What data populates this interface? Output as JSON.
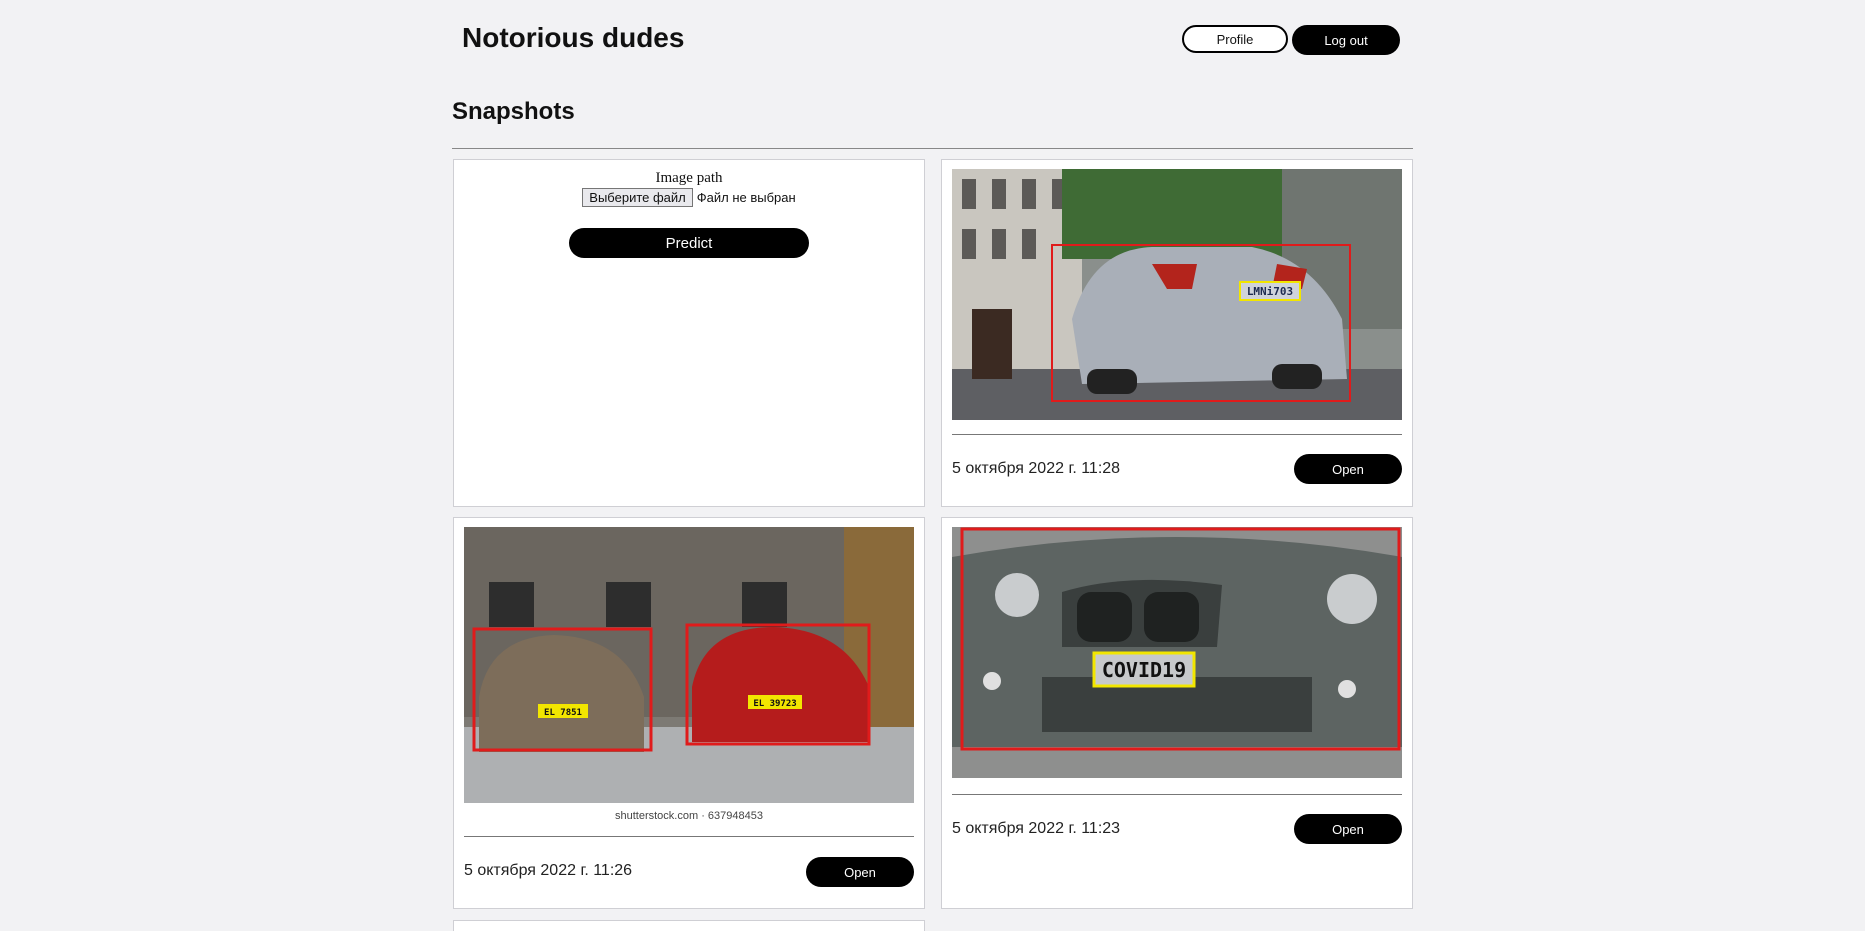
{
  "header": {
    "title": "Notorious dudes",
    "profile_label": "Profile",
    "logout_label": "Log out"
  },
  "section": {
    "title": "Snapshots"
  },
  "upload": {
    "label": "Image path",
    "file_button": "Выберите файл",
    "file_status": "Файл не выбран",
    "predict_label": "Predict"
  },
  "snapshots": [
    {
      "timestamp": "5 октября 2022 г. 11:28",
      "open_label": "Open",
      "plates": [
        "LMNi703"
      ]
    },
    {
      "timestamp": "5 октября 2022 г. 11:26",
      "open_label": "Open",
      "plates": [
        "EL 7851",
        "EL 39723"
      ],
      "caption": "shutterstock.com · 637948453"
    },
    {
      "timestamp": "5 октября 2022 г. 11:23",
      "open_label": "Open",
      "plates": [
        "COVID19"
      ]
    }
  ],
  "colors": {
    "accent": "#000000",
    "car_box": "#e01b1b",
    "plate_box": "#f2e600",
    "background": "#f2f2f4"
  }
}
